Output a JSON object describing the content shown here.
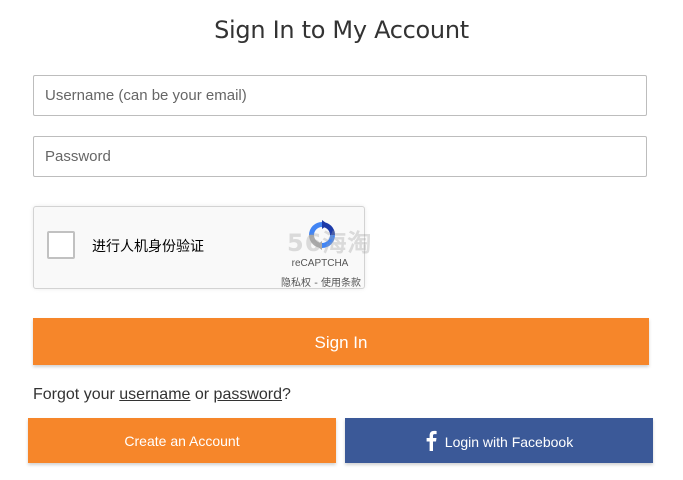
{
  "title": "Sign In to My Account",
  "form": {
    "username_placeholder": "Username (can be your email)",
    "password_placeholder": "Password"
  },
  "recaptcha": {
    "label": "进行人机身份验证",
    "brand": "reCAPTCHA",
    "terms": "隐私权 - 使用条款"
  },
  "watermark": "56海淘",
  "buttons": {
    "sign_in": "Sign In",
    "create_account": "Create an Account",
    "facebook": "Login with Facebook"
  },
  "forgot": {
    "prefix": "Forgot your ",
    "username_link": "username",
    "middle": " or ",
    "password_link": "password",
    "suffix": "?"
  },
  "colors": {
    "primary_orange": "#f6862a",
    "facebook_blue": "#3b5998"
  },
  "icons": {
    "recaptcha": "recaptcha-logo-icon",
    "facebook": "facebook-icon"
  }
}
